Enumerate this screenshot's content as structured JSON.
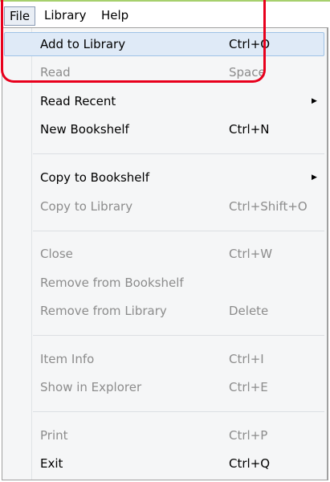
{
  "menubar": {
    "file": "File",
    "library": "Library",
    "help": "Help"
  },
  "file_menu": {
    "items": [
      {
        "label": "Add to Library",
        "shortcut": "Ctrl+O",
        "state": "highlighted"
      },
      {
        "label": "Read",
        "shortcut": "Space",
        "state": "disabled"
      },
      {
        "label": "Read Recent",
        "shortcut": "",
        "submenu": true,
        "state": "enabled"
      },
      {
        "label": "New Bookshelf",
        "shortcut": "Ctrl+N",
        "state": "enabled"
      },
      {
        "label": "Copy to Bookshelf",
        "shortcut": "",
        "submenu": true,
        "state": "enabled"
      },
      {
        "label": "Copy to Library",
        "shortcut": "Ctrl+Shift+O",
        "state": "disabled"
      },
      {
        "label": "Close",
        "shortcut": "Ctrl+W",
        "state": "disabled"
      },
      {
        "label": "Remove from Bookshelf",
        "shortcut": "",
        "state": "disabled"
      },
      {
        "label": "Remove from Library",
        "shortcut": "Delete",
        "state": "disabled"
      },
      {
        "label": "Item Info",
        "shortcut": "Ctrl+I",
        "state": "disabled"
      },
      {
        "label": "Show in Explorer",
        "shortcut": "Ctrl+E",
        "state": "disabled"
      },
      {
        "label": "Print",
        "shortcut": "Ctrl+P",
        "state": "disabled"
      },
      {
        "label": "Exit",
        "shortcut": "Ctrl+Q",
        "state": "enabled"
      }
    ],
    "submenu_arrow": "▶"
  },
  "colors": {
    "annotation": "#e8001c",
    "hover_fill": "#dfeaf7",
    "disabled_text": "#8c8c8c"
  }
}
